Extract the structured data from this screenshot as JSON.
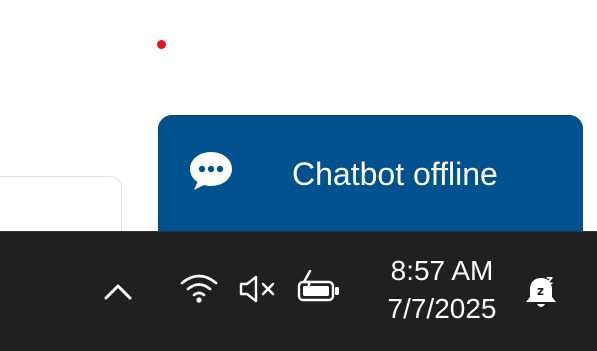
{
  "chat_widget": {
    "label": "Chatbot offline",
    "icon": "chat-bubble-icon",
    "background": "#00528f"
  },
  "taskbar": {
    "icons": [
      "chevron-up-icon",
      "wifi-icon",
      "volume-muted-icon",
      "battery-charging-icon",
      "notification-bell-snooze-icon"
    ],
    "time": "8:57 AM",
    "date": "7/7/2025",
    "background": "#202020"
  },
  "colors": {
    "notification_dot": "#e81123"
  }
}
